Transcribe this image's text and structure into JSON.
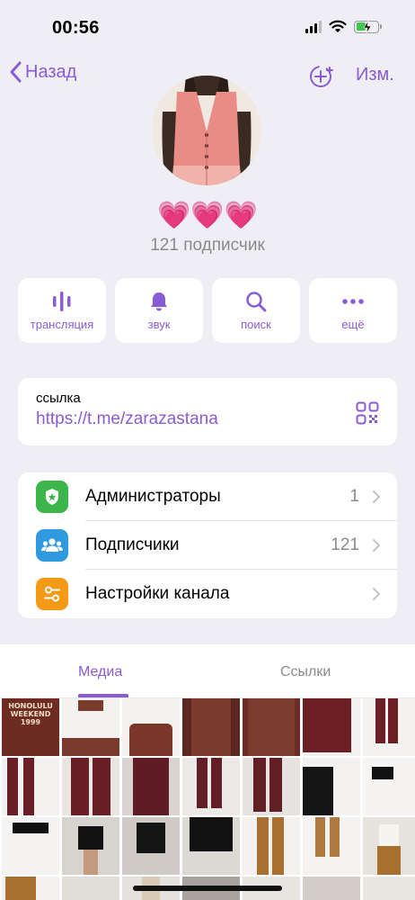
{
  "status": {
    "time": "00:56"
  },
  "nav": {
    "back_label": "Назад",
    "edit_label": "Изм."
  },
  "channel": {
    "name_emoji": "💗💗💗",
    "subscribers": "121 подписчик"
  },
  "actions": [
    {
      "label": "трансляция",
      "icon": "live-stream-icon"
    },
    {
      "label": "звук",
      "icon": "bell-icon"
    },
    {
      "label": "поиск",
      "icon": "search-icon"
    },
    {
      "label": "ещё",
      "icon": "more-icon"
    }
  ],
  "link": {
    "label": "ссылка",
    "url": "https://t.me/zarazastana"
  },
  "settings": [
    {
      "label": "Администраторы",
      "value": "1",
      "icon": "admin-shield-icon",
      "color": "#3cb64a"
    },
    {
      "label": "Подписчики",
      "value": "121",
      "icon": "people-icon",
      "color": "#2f9ae0"
    },
    {
      "label": "Настройки канала",
      "value": "",
      "icon": "sliders-icon",
      "color": "#f49a16"
    }
  ],
  "tabs": {
    "media": "Медиа",
    "links": "Ссылки"
  },
  "media_text": {
    "honolulu": "HONOLULU WEEKEND 1999"
  },
  "colors": {
    "accent": "#8a5bd6",
    "background": "#efeef4"
  }
}
